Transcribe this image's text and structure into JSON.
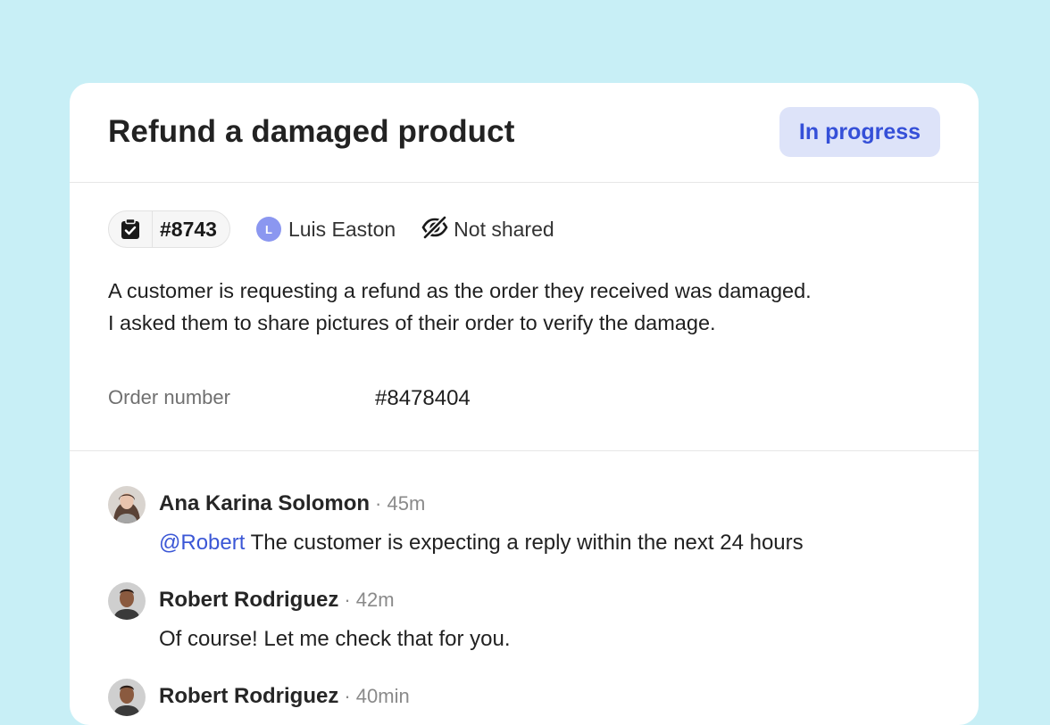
{
  "ticket": {
    "title": "Refund a damaged product",
    "status": "In progress",
    "number": "#8743",
    "assignee_initial": "L",
    "assignee": "Luis Easton",
    "sharing": "Not shared",
    "description_line1": "A customer is requesting a refund as the order they received was damaged.",
    "description_line2": "I asked them to share pictures of their order to verify the damage.",
    "fields": [
      {
        "label": "Order number",
        "value": "#8478404"
      }
    ]
  },
  "comments": [
    {
      "author": "Ana Karina Solomon",
      "time": "· 45m",
      "mention": "@Robert",
      "text": " The customer is expecting a reply within the next 24 hours"
    },
    {
      "author": "Robert Rodriguez",
      "time": "· 42m",
      "text": "Of course! Let me check that for you."
    },
    {
      "author": "Robert Rodriguez",
      "time": "· 40min"
    }
  ],
  "colors": {
    "background": "#c8eff6",
    "status_bg": "#dde3f9",
    "status_text": "#3550d8",
    "mention": "#3b57d6",
    "assignee_avatar": "#8b97f0"
  },
  "icons": {
    "ticket": "clipboard-check-icon",
    "sharing": "eye-off-icon"
  }
}
